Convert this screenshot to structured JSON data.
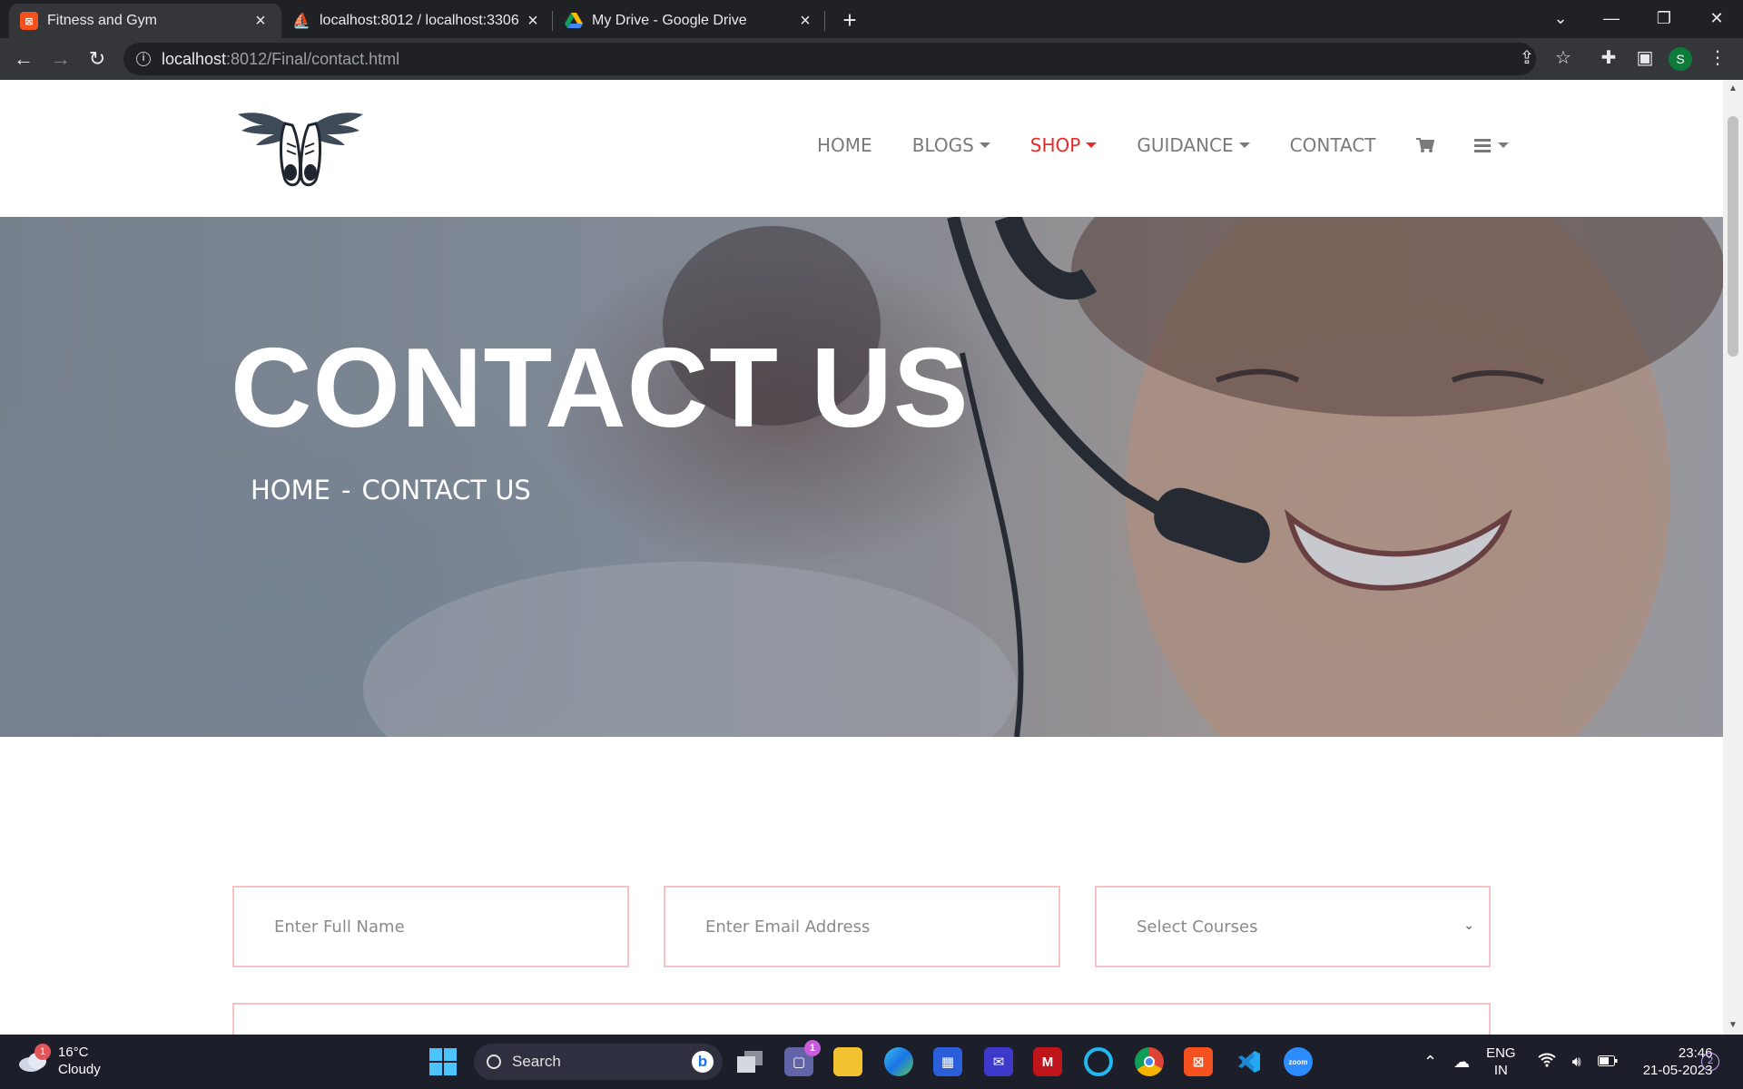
{
  "browser": {
    "tabs": [
      {
        "title": "Fitness and Gym",
        "favicon_color": "#f4511e",
        "favicon_glyph": "⊠",
        "active": true
      },
      {
        "title": "localhost:8012 / localhost:3306 /",
        "favicon_color": "#6c78af",
        "favicon_glyph": "⛵",
        "active": false
      },
      {
        "title": "My Drive - Google Drive",
        "favicon_color": "#1fa463",
        "favicon_glyph": "▲",
        "active": false
      }
    ],
    "url_host": "localhost",
    "url_path": ":8012/Final/contact.html",
    "profile_initial": "S"
  },
  "site": {
    "nav": {
      "items": [
        {
          "label": "HOME",
          "dropdown": false,
          "active": false
        },
        {
          "label": "BLOGS",
          "dropdown": true,
          "active": false
        },
        {
          "label": "SHOP",
          "dropdown": true,
          "active": true
        },
        {
          "label": "GUIDANCE",
          "dropdown": true,
          "active": false
        },
        {
          "label": "CONTACT",
          "dropdown": false,
          "active": false
        }
      ],
      "accent_color": "#e82a2a",
      "cart_icon": "cart-icon",
      "menu_icon": "hamburger-menu-icon"
    },
    "hero": {
      "title": "CONTACT US",
      "breadcrumb_home": "HOME",
      "breadcrumb_sep": "-",
      "breadcrumb_current": "CONTACT US"
    },
    "form": {
      "full_name_placeholder": "Enter Full Name",
      "email_placeholder": "Enter Email Address",
      "course_select_value": "Select Courses",
      "field_border_color": "#f5c3c3"
    }
  },
  "taskbar": {
    "weather_temp": "16°C",
    "weather_desc": "Cloudy",
    "weather_badge": "1",
    "search_label": "Search",
    "teams_badge": "1",
    "lang_line1": "ENG",
    "lang_line2": "IN",
    "time": "23:46",
    "date": "21-05-2023",
    "notification_count": "2"
  }
}
